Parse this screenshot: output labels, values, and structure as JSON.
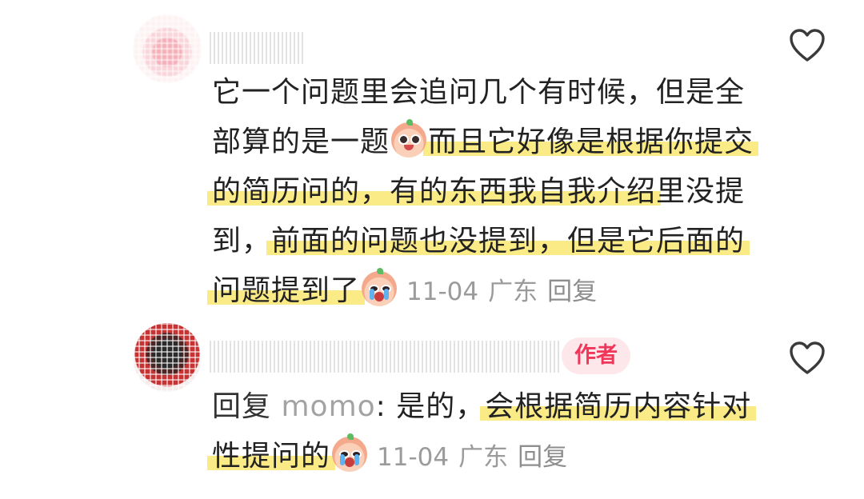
{
  "comments": [
    {
      "text_plain_1": "它一个问题里会追问几个有时候，但是全部算的是一题",
      "emoji_1": "surprised-face-emoji",
      "text_hl_1": "而且它好像是根据你提交的简历问的，有的东西我自我介绍",
      "text_plain_2": "里没提到，",
      "text_hl_2": "前面的问题也没提到，但是它后面的问题提到了",
      "emoji_2": "crying-face-emoji",
      "date": "11-04",
      "location": "广东",
      "reply_label": "回复"
    },
    {
      "is_author": true,
      "author_badge": "作者",
      "reply_prefix": "回复",
      "mention": "momo",
      "text_plain_1": ": 是的，",
      "text_hl_1": "会根据简历内容针对性提问的",
      "emoji_1": "crying-face-emoji",
      "date": "11-04",
      "location": "广东",
      "reply_label": "回复"
    }
  ],
  "icons": {
    "like": "heart-outline-icon"
  },
  "colors": {
    "highlight": "#fbeb86",
    "author_badge_bg": "#fde7ea",
    "author_badge_text": "#f0375a",
    "meta_text": "#9b9b9b",
    "mention_text": "#a3a3a3",
    "body_text": "#222222"
  }
}
